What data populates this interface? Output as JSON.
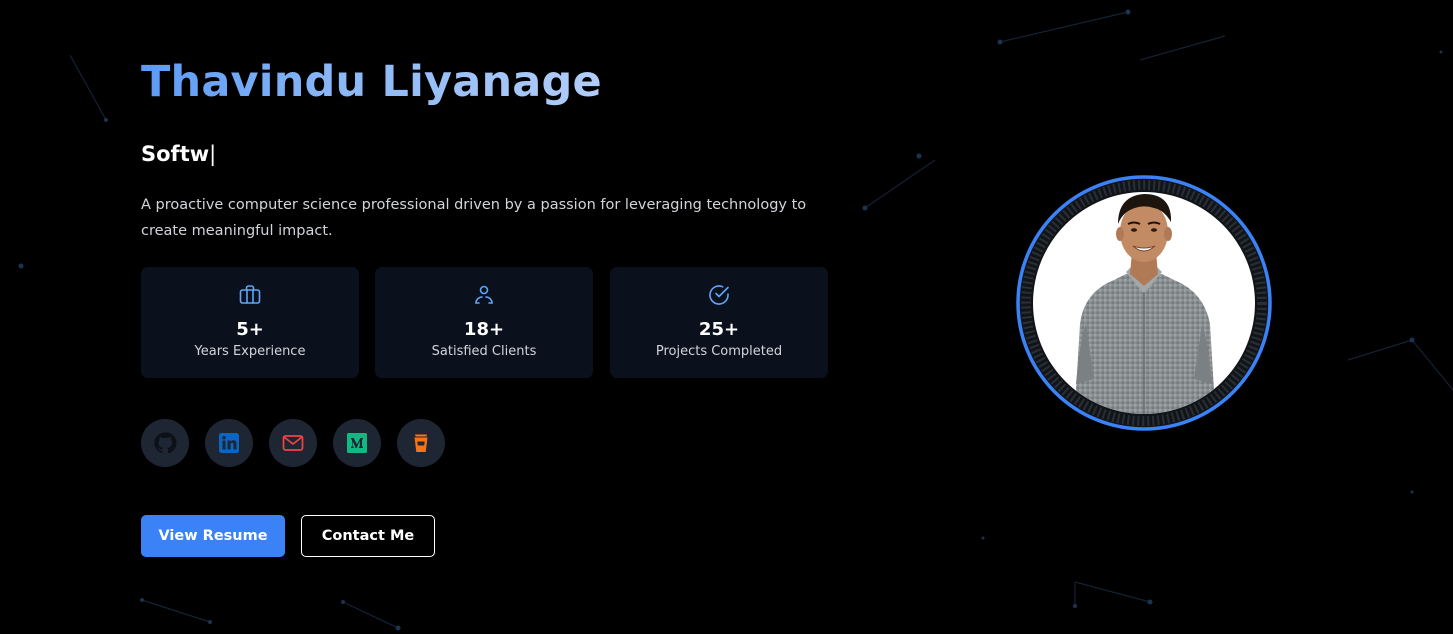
{
  "hero": {
    "name": "Thavindu Liyanage",
    "typed_role": "Softw",
    "cursor": "|",
    "bio": "A proactive computer science professional driven by a passion for leveraging technology to create meaningful impact."
  },
  "stats": [
    {
      "icon": "briefcase-icon",
      "value": "5+",
      "label": "Years Experience"
    },
    {
      "icon": "users-icon",
      "value": "18+",
      "label": "Satisfied Clients"
    },
    {
      "icon": "check-circle-icon",
      "value": "25+",
      "label": "Projects Completed"
    }
  ],
  "socials": [
    {
      "icon": "github-icon",
      "color": "#0d1117"
    },
    {
      "icon": "linkedin-icon",
      "color": "#0a66c2"
    },
    {
      "icon": "mail-icon",
      "color": "#ef4444"
    },
    {
      "icon": "medium-icon",
      "color": "#10b981"
    },
    {
      "icon": "coffee-icon",
      "color": "#f97316"
    }
  ],
  "buttons": {
    "primary": "View Resume",
    "secondary": "Contact Me"
  },
  "colors": {
    "background": "#000000",
    "accent": "#3b82f6",
    "name_gradient": [
      "#5b9bf5",
      "#b2cdf8"
    ],
    "card_bg": "#0b111c",
    "social_bg": "#1f2633",
    "stat_icon": "#60a5fa",
    "portrait_ring": "#3b82f6"
  }
}
